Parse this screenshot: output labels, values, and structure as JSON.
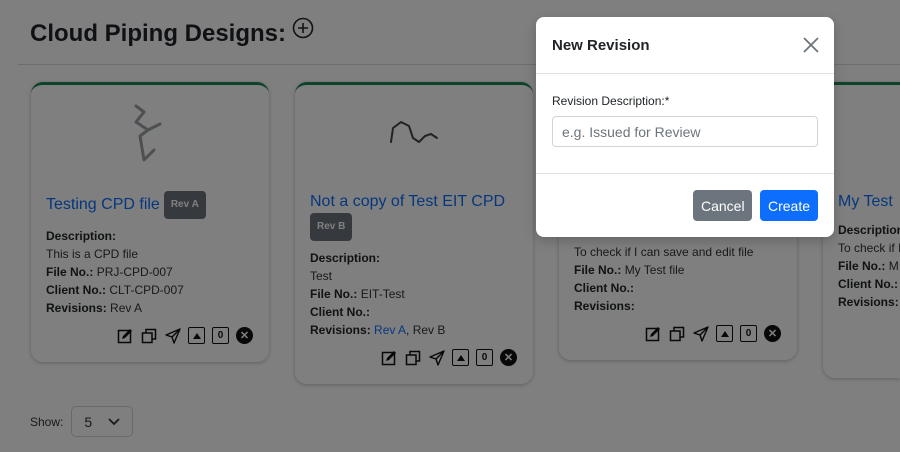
{
  "page": {
    "title": "Cloud Piping Designs:",
    "add_icon": "plus-circle-icon"
  },
  "labels": {
    "description": "Description:",
    "file_no": "File No.:",
    "client_no": "Client No.:",
    "revisions": "Revisions:"
  },
  "cards": [
    {
      "title": "Testing CPD file",
      "badge": "Rev A",
      "description": "This is a CPD file",
      "file_no": "PRJ-CPD-007",
      "client_no": "CLT-CPD-007",
      "revisions_text": "Rev A",
      "count": "0"
    },
    {
      "title": "Not a copy of Test EIT CPD",
      "badge": "Rev B",
      "description": "Test",
      "file_no": "EIT-Test",
      "client_no": "",
      "revisions_link": "Rev A",
      "revisions_text": ", Rev B",
      "count": "0"
    },
    {
      "description": "To check if I can save and edit file",
      "file_no": "My Test file",
      "client_no": "",
      "revisions_text": "",
      "count": "0"
    },
    {
      "title": "My Test",
      "description": "To check if I",
      "file_no": "M",
      "client_no": "",
      "revisions_text": ""
    }
  ],
  "pagination": {
    "show_label": "Show:",
    "page_size": "5"
  },
  "modal": {
    "title": "New Revision",
    "field_label": "Revision Description:*",
    "placeholder": "e.g. Issued for Review",
    "value": "",
    "cancel_label": "Cancel",
    "create_label": "Create"
  },
  "colors": {
    "accent": "#0d6efd",
    "card_border": "#198754",
    "badge": "#6c757d",
    "cancel_button": "#6c757d"
  }
}
